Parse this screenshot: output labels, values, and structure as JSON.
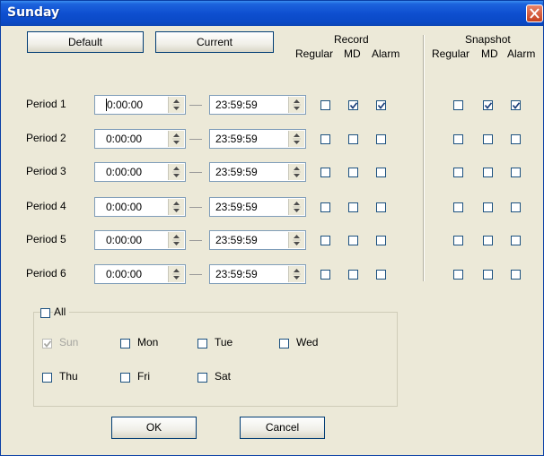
{
  "window": {
    "title": "Sunday"
  },
  "buttons": {
    "default": "Default",
    "current": "Current",
    "ok": "OK",
    "cancel": "Cancel"
  },
  "record": {
    "header": "Record",
    "cols": [
      "Regular",
      "MD",
      "Alarm"
    ]
  },
  "snapshot": {
    "header": "Snapshot",
    "cols": [
      "Regular",
      "MD",
      "Alarm"
    ]
  },
  "periods": [
    {
      "label": "Period 1",
      "start": "0:00:00",
      "end": "23:59:59",
      "record": [
        false,
        true,
        true
      ],
      "snapshot": [
        false,
        true,
        true
      ]
    },
    {
      "label": "Period 2",
      "start": "0:00:00",
      "end": "23:59:59",
      "record": [
        false,
        false,
        false
      ],
      "snapshot": [
        false,
        false,
        false
      ]
    },
    {
      "label": "Period 3",
      "start": "0:00:00",
      "end": "23:59:59",
      "record": [
        false,
        false,
        false
      ],
      "snapshot": [
        false,
        false,
        false
      ]
    },
    {
      "label": "Period 4",
      "start": "0:00:00",
      "end": "23:59:59",
      "record": [
        false,
        false,
        false
      ],
      "snapshot": [
        false,
        false,
        false
      ]
    },
    {
      "label": "Period 5",
      "start": "0:00:00",
      "end": "23:59:59",
      "record": [
        false,
        false,
        false
      ],
      "snapshot": [
        false,
        false,
        false
      ]
    },
    {
      "label": "Period 6",
      "start": "0:00:00",
      "end": "23:59:59",
      "record": [
        false,
        false,
        false
      ],
      "snapshot": [
        false,
        false,
        false
      ]
    }
  ],
  "days": {
    "all": {
      "label": "All",
      "checked": false
    },
    "items": [
      {
        "label": "Sun",
        "checked": true,
        "disabled": true
      },
      {
        "label": "Mon",
        "checked": false,
        "disabled": false
      },
      {
        "label": "Tue",
        "checked": false,
        "disabled": false
      },
      {
        "label": "Wed",
        "checked": false,
        "disabled": false
      },
      {
        "label": "Thu",
        "checked": false,
        "disabled": false
      },
      {
        "label": "Fri",
        "checked": false,
        "disabled": false
      },
      {
        "label": "Sat",
        "checked": false,
        "disabled": false
      }
    ]
  },
  "icons": [
    "close-icon",
    "spin-up-icon",
    "spin-down-icon",
    "checkmark-icon"
  ]
}
